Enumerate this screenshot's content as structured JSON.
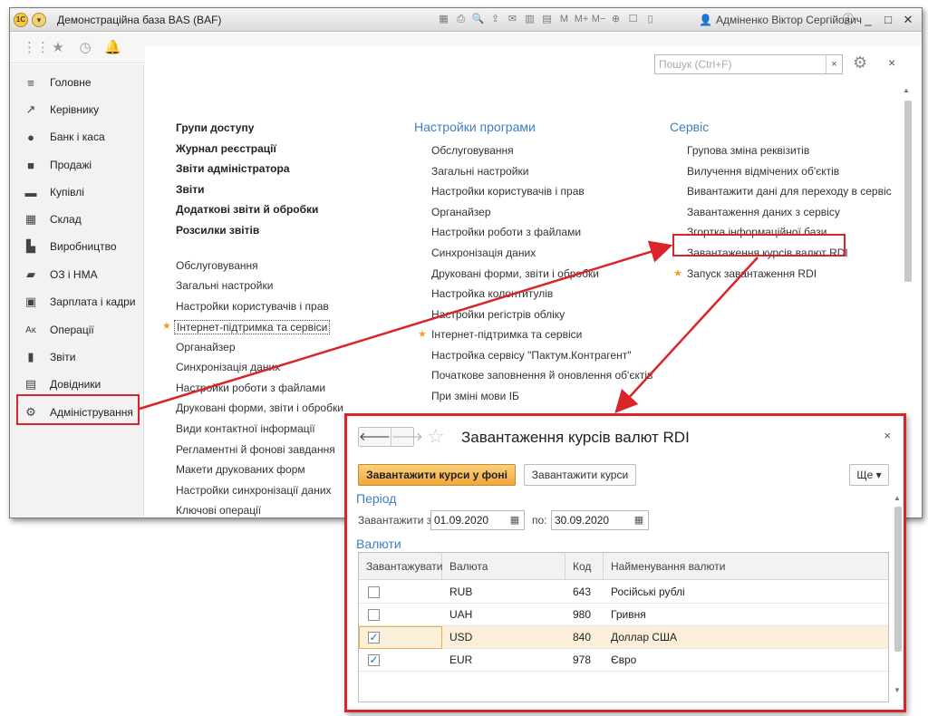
{
  "window": {
    "title": "Демонстраційна база BAS  (BAF)",
    "logo": "1С",
    "user": "Адміненко Віктор Сергійович",
    "toolbar_icons": [
      "▦",
      "⎙",
      "🔍",
      "⇪",
      "✉",
      "▥",
      "▤",
      "M",
      "M+",
      "M−",
      "⊕",
      "☐",
      "▯"
    ],
    "info_icon": "ⓘ",
    "min": "_",
    "max": "□",
    "close": "✕"
  },
  "topnav": {
    "apps_icon": "⋮⋮",
    "star_icon": "★",
    "history_icon": "◷",
    "bell_icon": "🔔"
  },
  "sidebar": {
    "items": [
      {
        "label": "Головне",
        "icon": "≡"
      },
      {
        "label": "Керівнику",
        "icon": "↗"
      },
      {
        "label": "Банк і каса",
        "icon": "●"
      },
      {
        "label": "Продажі",
        "icon": "■"
      },
      {
        "label": "Купівлі",
        "icon": "▬"
      },
      {
        "label": "Склад",
        "icon": "▦"
      },
      {
        "label": "Виробництво",
        "icon": "▙"
      },
      {
        "label": "ОЗ і НМА",
        "icon": "▰"
      },
      {
        "label": "Зарплата і кадри",
        "icon": "▣"
      },
      {
        "label": "Операції",
        "icon": "Аᴋ"
      },
      {
        "label": "Звіти",
        "icon": "▮"
      },
      {
        "label": "Довідники",
        "icon": "▤"
      },
      {
        "label": "Адміністрування",
        "icon": "⚙"
      }
    ]
  },
  "search": {
    "placeholder": "Пошук (Ctrl+F)",
    "clear": "×"
  },
  "content": {
    "close": "×",
    "col1_bold": [
      "Групи доступу",
      "Журнал реєстрації",
      "Звіти адміністратора",
      "Звіти",
      "Додаткові звіти й обробки",
      "Розсилки звітів"
    ],
    "col1_links": [
      "Обслуговування",
      "Загальні настройки",
      "Настройки користувачів і прав",
      "Інтернет-підтримка та сервіси",
      "Органайзер",
      "Синхронізація даних",
      "Настройки роботи з файлами",
      "Друковані форми, звіти і обробки",
      "Види контактної інформації",
      "Регламентні й фонові завдання",
      "Макети друкованих форм",
      "Настройки синхронізації даних",
      "Ключові операції"
    ],
    "col2_title": "Настройки програми",
    "col2_links": [
      "Обслуговування",
      "Загальні настройки",
      "Настройки користувачів і прав",
      "Органайзер",
      "Настройки роботи з файлами",
      "Синхронізація даних",
      "Друковані форми, звіти і обробки",
      "Настройка колонтитулів",
      "Настройки регістрів обліку",
      "Інтернет-підтримка та сервіси",
      "Настройка сервісу \"Пактум.Контрагент\"",
      "Початкове заповнення й оновлення об'єктів",
      "При зміні мови ІБ"
    ],
    "col3_title": "Сервіс",
    "col3_links": [
      "Групова зміна реквізитів",
      "Вилучення відмічених об'єктів",
      "Вивантажити дані для переходу в сервіс",
      "Завантаження даних з сервісу",
      "Згортка інформаційної бази",
      "Завантаження курсів валют RDI",
      "Запуск завантаження RDI"
    ]
  },
  "dialog": {
    "back": "🡐",
    "forward": "🡒",
    "title": "Завантаження курсів валют RDI",
    "close": "×",
    "btn_primary": "Завантажити курси у фоні",
    "btn_secondary": "Завантажити курси",
    "btn_more": "Ще ▾",
    "period_title": "Період",
    "from_label": "Завантажити з:",
    "from_value": "01.09.2020",
    "to_label": "по:",
    "to_value": "30.09.2020",
    "currencies_title": "Валюти",
    "table": {
      "headers": [
        "Завантажувати",
        "Валюта",
        "Код",
        "Найменування валюти"
      ],
      "rows": [
        {
          "checked": false,
          "currency": "RUB",
          "code": "643",
          "name": "Російські рублі"
        },
        {
          "checked": false,
          "currency": "UAH",
          "code": "980",
          "name": "Гривня"
        },
        {
          "checked": true,
          "currency": "USD",
          "code": "840",
          "name": "Доллар США"
        },
        {
          "checked": true,
          "currency": "EUR",
          "code": "978",
          "name": "Євро"
        }
      ]
    }
  },
  "colors": {
    "accent_blue": "#3e7fc1",
    "highlight_red": "#d9242a",
    "primary_button": "#f1a83d"
  }
}
